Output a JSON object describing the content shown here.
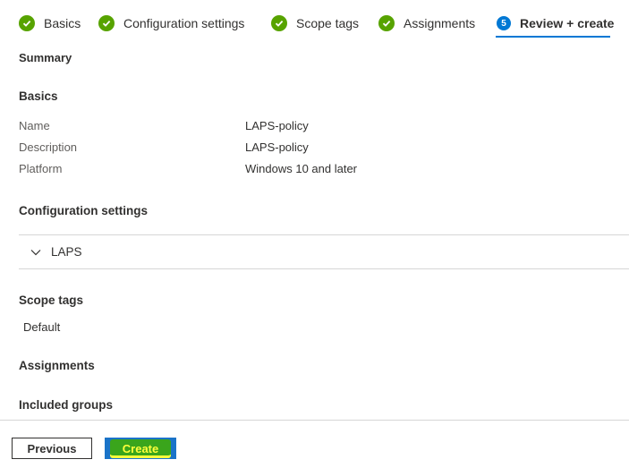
{
  "wizard": {
    "steps": [
      {
        "label": "Basics",
        "state": "complete"
      },
      {
        "label": "Configuration settings",
        "state": "complete"
      },
      {
        "label": "Scope tags",
        "state": "complete"
      },
      {
        "label": "Assignments",
        "state": "complete"
      },
      {
        "label": "Review + create",
        "state": "active",
        "number": "5"
      }
    ]
  },
  "summary": {
    "title": "Summary"
  },
  "basics": {
    "title": "Basics",
    "fields": [
      {
        "label": "Name",
        "value": "LAPS-policy"
      },
      {
        "label": "Description",
        "value": "LAPS-policy"
      },
      {
        "label": "Platform",
        "value": "Windows 10 and later"
      }
    ]
  },
  "configuration": {
    "title": "Configuration settings",
    "accordion_label": "LAPS"
  },
  "scope_tags": {
    "title": "Scope tags",
    "value": "Default"
  },
  "assignments": {
    "title": "Assignments",
    "included_groups_title": "Included groups"
  },
  "footer": {
    "previous_label": "Previous",
    "create_label": "Create"
  },
  "colors": {
    "accent": "#0078d4",
    "complete": "#57a300",
    "highlight_fill": "#3aa51c",
    "highlight_text": "#ffff3b"
  },
  "icons": {
    "complete": "checkmark-circle-icon",
    "accordion": "chevron-down-icon"
  }
}
